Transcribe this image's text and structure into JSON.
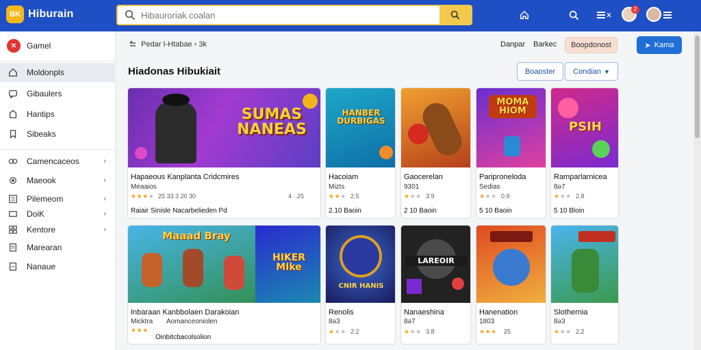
{
  "app": {
    "logo_text": "BK",
    "name": "Hiburain"
  },
  "search": {
    "placeholder": "Hibauroriak coalan"
  },
  "sidebar": {
    "items": [
      {
        "label": "Gamel",
        "icon": "game-logo-icon"
      },
      {
        "label": "Moldonpls",
        "icon": "home-icon"
      },
      {
        "label": "Gibaulers",
        "icon": "chat-icon"
      },
      {
        "label": "Hantips",
        "icon": "tag-icon"
      },
      {
        "label": "Sibeaks",
        "icon": "bookmark-icon"
      },
      {
        "label": "Camencaceos",
        "icon": "gamepad-icon"
      },
      {
        "label": "Maeook",
        "icon": "controller-icon"
      },
      {
        "label": "Pilemeom",
        "icon": "list-icon"
      },
      {
        "label": "DoiK",
        "icon": "card-icon"
      },
      {
        "label": "Kentore",
        "icon": "grid-icon"
      },
      {
        "label": "Marearan",
        "icon": "doc-icon"
      },
      {
        "label": "Nanaue",
        "icon": "file-icon"
      }
    ]
  },
  "breadcrumb": {
    "text": "Pedar I-Htabae › 3k"
  },
  "toplinks": {
    "a": "Danpar",
    "b": "Barkec"
  },
  "buttons": {
    "pill": "Boopdonost",
    "primary": "Kama",
    "filter": "Boaoster",
    "sort": "Condian"
  },
  "section": {
    "title": "Hiadonas Hibukiait"
  },
  "cards_row1": [
    {
      "title": "Hapaeous Kanplanta Cridcmires",
      "sub": "Meaaios",
      "rating_text": "25 33 3 20 30",
      "rating_count": "4 · 25",
      "stars": 3,
      "price": "Raiair Sinisle Nacarbelieden Pd",
      "thumb_text": "SUMAS\nNANEAS"
    },
    {
      "title": "Hacoiam",
      "sub": "Mizts",
      "rating_text": "2.5",
      "stars": 2,
      "price": "2.10 Baoin",
      "thumb_text": "HANBER\nDURBIGAS"
    },
    {
      "title": "Gaocerelan",
      "sub": "9301",
      "rating_text": "3.9",
      "stars": 1,
      "price": "2 10 Baoin",
      "thumb_text": ""
    },
    {
      "title": "Pariproneloda",
      "sub": "Sedias",
      "rating_text": "0.9",
      "stars": 1,
      "price": "5 10 Baoin",
      "thumb_text": "MOMA\nHIOM"
    },
    {
      "title": "Ramparlarnicea",
      "sub": "8ə7",
      "rating_text": "2.8",
      "stars": 1,
      "price": "5 10 Bloin",
      "thumb_text": "PSIH"
    }
  ],
  "cards_row2": [
    {
      "title": "Inbaraan Kanbbolaen Darakoian",
      "sub": "Micktra",
      "sub2": "Aomanceoniolen",
      "stars": 3,
      "price": "Oinbitcbacolsolion",
      "thumb_text": "Maaad Bray",
      "thumb_text2": "HIKER\nMIke"
    },
    {
      "title": "Renolis",
      "sub": "8ə3",
      "rating_text": "2.2",
      "stars": 1,
      "thumb_text": "CNIR HANIS"
    },
    {
      "title": "Nanaeshina",
      "sub": "8ə7",
      "rating_text": "3.8",
      "stars": 1,
      "thumb_text": "LAREOIR"
    },
    {
      "title": "Hanenation",
      "sub": "1803",
      "rating_text": "25",
      "stars": 3,
      "thumb_text": ""
    },
    {
      "title": "Slothernia",
      "sub": "8ə3",
      "rating_text": "2.2",
      "stars": 1,
      "thumb_text": ""
    }
  ]
}
